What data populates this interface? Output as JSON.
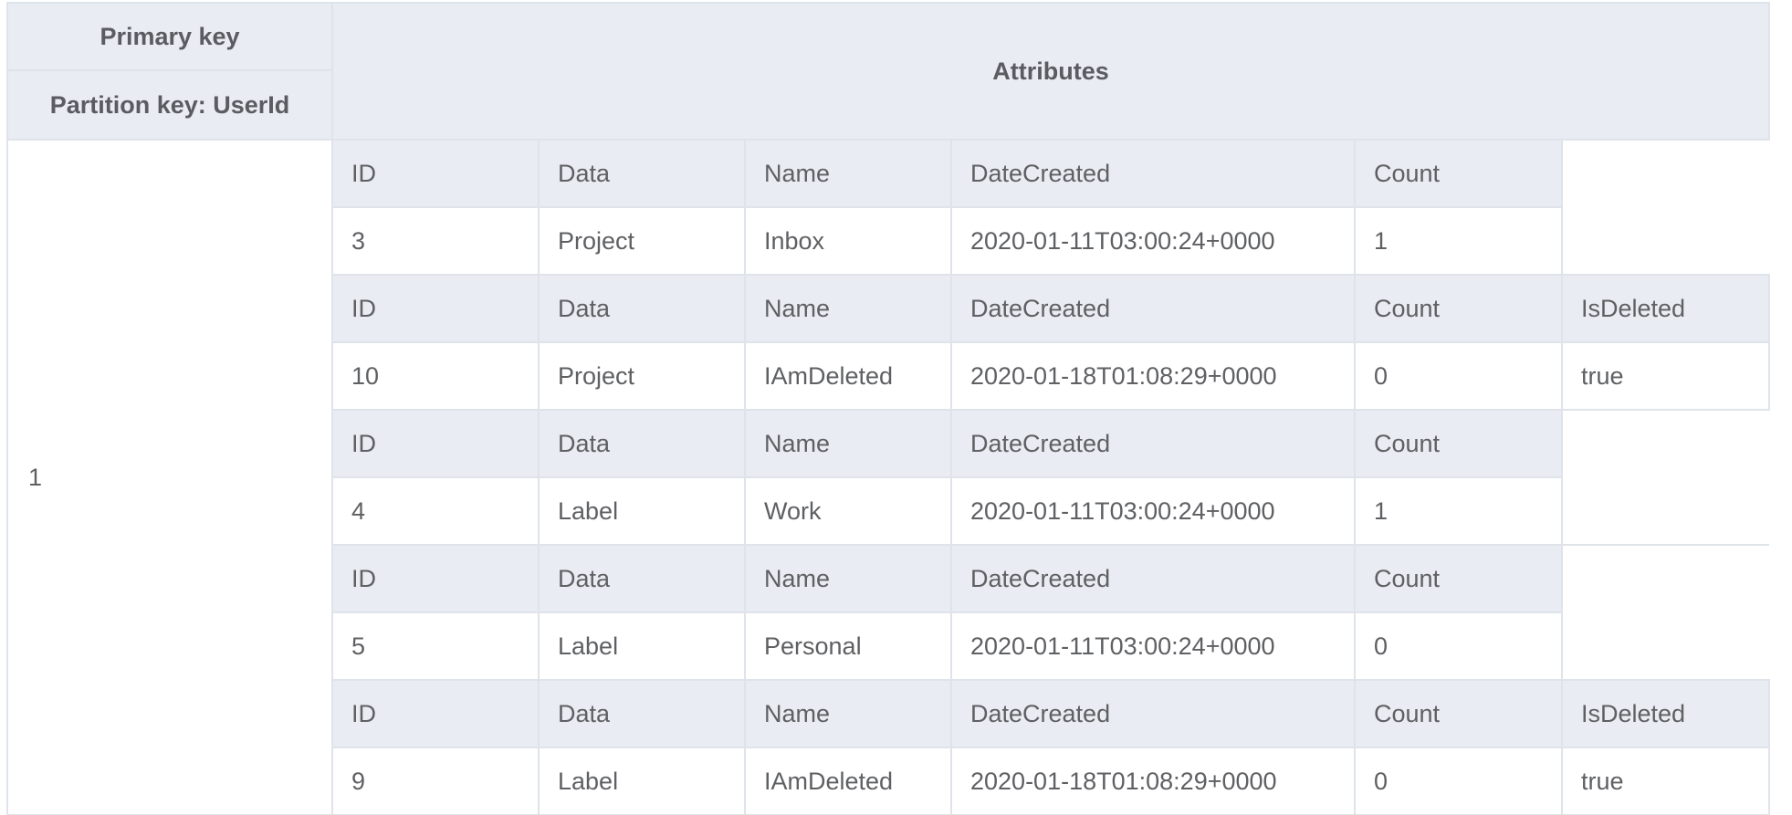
{
  "header": {
    "primary_key": "Primary key",
    "partition_key": "Partition key: UserId",
    "attributes": "Attributes"
  },
  "partition_value": "1",
  "items": [
    {
      "headers": [
        "ID",
        "Data",
        "Name",
        "DateCreated",
        "Count"
      ],
      "values": [
        "3",
        "Project",
        "Inbox",
        "2020-01-11T03:00:24+0000",
        "1"
      ]
    },
    {
      "headers": [
        "ID",
        "Data",
        "Name",
        "DateCreated",
        "Count",
        "IsDeleted"
      ],
      "values": [
        "10",
        "Project",
        "IAmDeleted",
        "2020-01-18T01:08:29+0000",
        "0",
        "true"
      ]
    },
    {
      "headers": [
        "ID",
        "Data",
        "Name",
        "DateCreated",
        "Count"
      ],
      "values": [
        "4",
        "Label",
        "Work",
        "2020-01-11T03:00:24+0000",
        "1"
      ]
    },
    {
      "headers": [
        "ID",
        "Data",
        "Name",
        "DateCreated",
        "Count"
      ],
      "values": [
        "5",
        "Label",
        "Personal",
        "2020-01-11T03:00:24+0000",
        "0"
      ]
    },
    {
      "headers": [
        "ID",
        "Data",
        "Name",
        "DateCreated",
        "Count",
        "IsDeleted"
      ],
      "values": [
        "9",
        "Label",
        "IAmDeleted",
        "2020-01-18T01:08:29+0000",
        "0",
        "true"
      ]
    }
  ]
}
